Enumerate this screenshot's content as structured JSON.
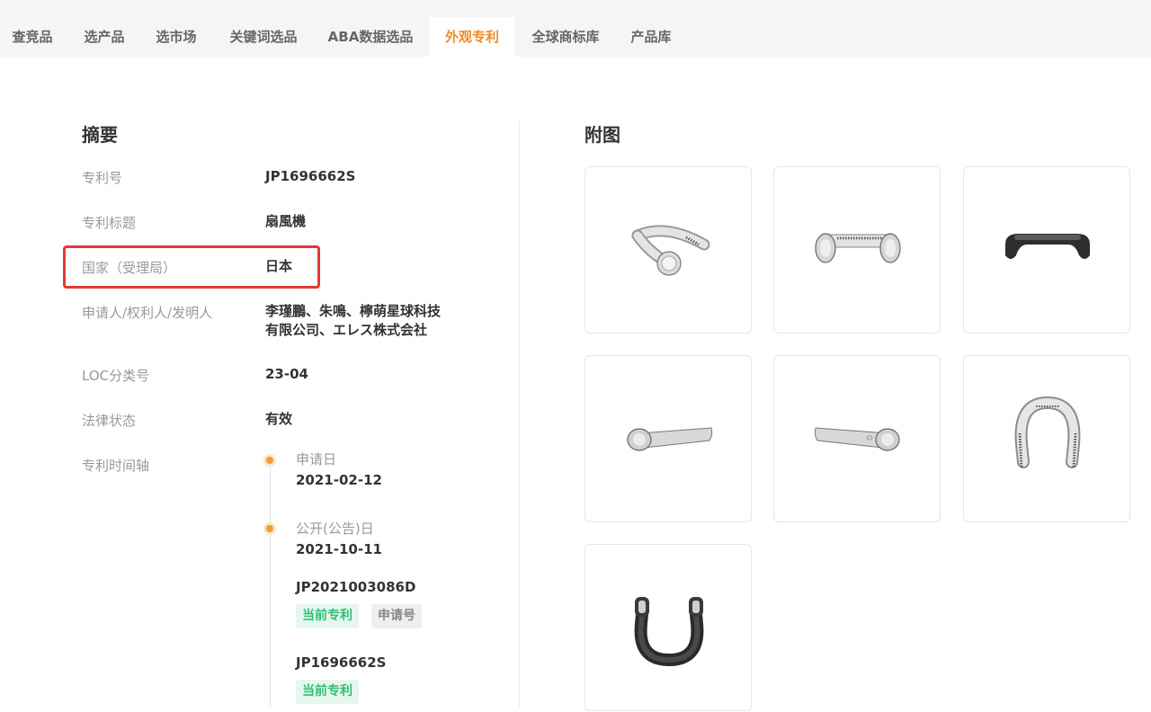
{
  "tabs": [
    {
      "label": "查竞品",
      "active": false
    },
    {
      "label": "选产品",
      "active": false
    },
    {
      "label": "选市场",
      "active": false
    },
    {
      "label": "关键词选品",
      "active": false
    },
    {
      "label": "ABA数据选品",
      "active": false
    },
    {
      "label": "外观专利",
      "active": true
    },
    {
      "label": "全球商标库",
      "active": false
    },
    {
      "label": "产品库",
      "active": false
    }
  ],
  "summary": {
    "title": "摘要",
    "rows": [
      {
        "label": "专利号",
        "value": "JP1696662S"
      },
      {
        "label": "专利标题",
        "value": "扇風機"
      },
      {
        "label": "国家（受理局）",
        "value": "日本"
      },
      {
        "label": "申请人/权利人/发明人",
        "value_line1": "李瑾鵬、朱鳴、檸萌星球科技",
        "value_line2": "有限公司、エレス株式会社"
      },
      {
        "label": "LOC分类号",
        "value": "23-04"
      },
      {
        "label": "法律状态",
        "value": "有效"
      },
      {
        "label": "专利时间轴"
      }
    ]
  },
  "timeline": {
    "events": [
      {
        "label": "申请日",
        "date": "2021-02-12"
      },
      {
        "label": "公开(公告)日",
        "date": "2021-10-11"
      }
    ],
    "patents": [
      {
        "number": "JP2021003086D",
        "tags": [
          "当前专利",
          "申请号"
        ]
      },
      {
        "number": "JP1696662S",
        "tags": [
          "当前专利"
        ]
      }
    ]
  },
  "figures": {
    "title": "附图",
    "items": [
      {
        "name": "neck-fan-angled-view"
      },
      {
        "name": "neck-fan-front-view"
      },
      {
        "name": "neck-fan-back-view"
      },
      {
        "name": "neck-fan-left-side-view"
      },
      {
        "name": "neck-fan-right-side-view"
      },
      {
        "name": "neck-fan-top-view"
      },
      {
        "name": "neck-fan-bottom-view"
      }
    ]
  },
  "colors": {
    "accent": "#f08a24",
    "highlight": "#e53935",
    "tag_green": "#2fbf71",
    "tag_gray": "#888888"
  }
}
